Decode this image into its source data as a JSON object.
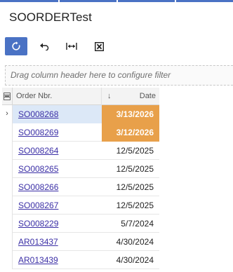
{
  "window": {
    "title": "SOORDERTest"
  },
  "toolbar": {
    "buttons": [
      {
        "icon": "refresh-icon"
      },
      {
        "icon": "undo-icon"
      },
      {
        "icon": "fit-width-icon"
      },
      {
        "icon": "excel-export-icon"
      }
    ]
  },
  "filter": {
    "placeholder": "Drag column header here to configure filter"
  },
  "grid": {
    "columns": {
      "order": "Order Nbr.",
      "date": "Date",
      "date_sort": "↓"
    },
    "active_row_marker": "›",
    "rows": [
      {
        "order": "SO008268",
        "date": "3/13/2026",
        "highlight": true
      },
      {
        "order": "SO008269",
        "date": "3/12/2026",
        "highlight": true
      },
      {
        "order": "SO008264",
        "date": "12/5/2025",
        "highlight": false
      },
      {
        "order": "SO008265",
        "date": "12/5/2025",
        "highlight": false
      },
      {
        "order": "SO008266",
        "date": "12/5/2025",
        "highlight": false
      },
      {
        "order": "SO008267",
        "date": "12/5/2025",
        "highlight": false
      },
      {
        "order": "SO008229",
        "date": "5/7/2024",
        "highlight": false
      },
      {
        "order": "AR013437",
        "date": "4/30/2024",
        "highlight": false
      },
      {
        "order": "AR013439",
        "date": "4/30/2024",
        "highlight": false
      }
    ]
  },
  "colors": {
    "accent": "#4a72c4",
    "highlight": "#e8a04a",
    "active_row": "#dce8f7",
    "link": "#3b2fa6"
  }
}
